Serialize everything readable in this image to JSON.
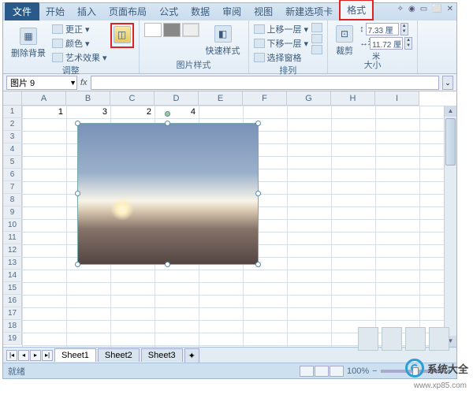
{
  "tabs": {
    "file": "文件",
    "items": [
      "开始",
      "插入",
      "页面布局",
      "公式",
      "数据",
      "审阅",
      "视图",
      "新建选项卡"
    ],
    "active": "格式"
  },
  "ribbon": {
    "adjust": {
      "label": "调整",
      "remove_bg": "删除背景",
      "correct": "更正",
      "color": "颜色",
      "effects": "艺术效果"
    },
    "styles": {
      "label": "图片样式",
      "quick": "快速样式"
    },
    "arrange": {
      "label": "排列",
      "up": "上移一层",
      "down": "下移一层",
      "pane": "选择窗格"
    },
    "size": {
      "label": "大小",
      "crop": "裁剪",
      "height": "7.33 厘米",
      "width": "11.72 厘米"
    }
  },
  "namebox": "图片 9",
  "fx": "fx",
  "columns": [
    "A",
    "B",
    "C",
    "D",
    "E",
    "F",
    "G",
    "H",
    "I"
  ],
  "rows": [
    "1",
    "2",
    "3",
    "4",
    "5",
    "6",
    "7",
    "8",
    "9",
    "10",
    "11",
    "12",
    "13",
    "14",
    "15",
    "16",
    "17",
    "18",
    "19"
  ],
  "cells": {
    "A1": "1",
    "B1": "3",
    "C1": "2",
    "D1": "4"
  },
  "sheets": [
    "Sheet1",
    "Sheet2",
    "Sheet3"
  ],
  "status": {
    "ready": "就绪",
    "zoom": "100%"
  },
  "watermark": {
    "text": "系统大全",
    "url": "www.xp85.com"
  }
}
